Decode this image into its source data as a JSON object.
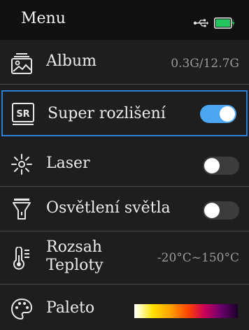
{
  "header": {
    "title": "Menu",
    "usb_icon": "usb-icon",
    "battery_icon": "battery-charging-icon",
    "battery_color": "#22c55e"
  },
  "menu": {
    "album": {
      "label": "Album",
      "value": "0.3G/12.7G",
      "icon": "album-icon"
    },
    "super_resolution": {
      "label": "Super rozlišení",
      "icon": "sr-icon",
      "toggle_on": true
    },
    "laser": {
      "label": "Laser",
      "icon": "laser-icon",
      "toggle_on": false
    },
    "light": {
      "label": "Osvětlení světla",
      "icon": "flashlight-icon",
      "toggle_on": false
    },
    "temperature_range": {
      "label_line1": "Rozsah",
      "label_line2": "Teploty",
      "value": "-20°C~150°C",
      "icon": "thermometer-icon"
    },
    "palette": {
      "label": "Paleto",
      "icon": "palette-icon"
    }
  },
  "colors": {
    "accent": "#4aa6f0",
    "selection_border": "#2f7fd6",
    "background": "#1e1e1e",
    "header_background": "#111111"
  }
}
